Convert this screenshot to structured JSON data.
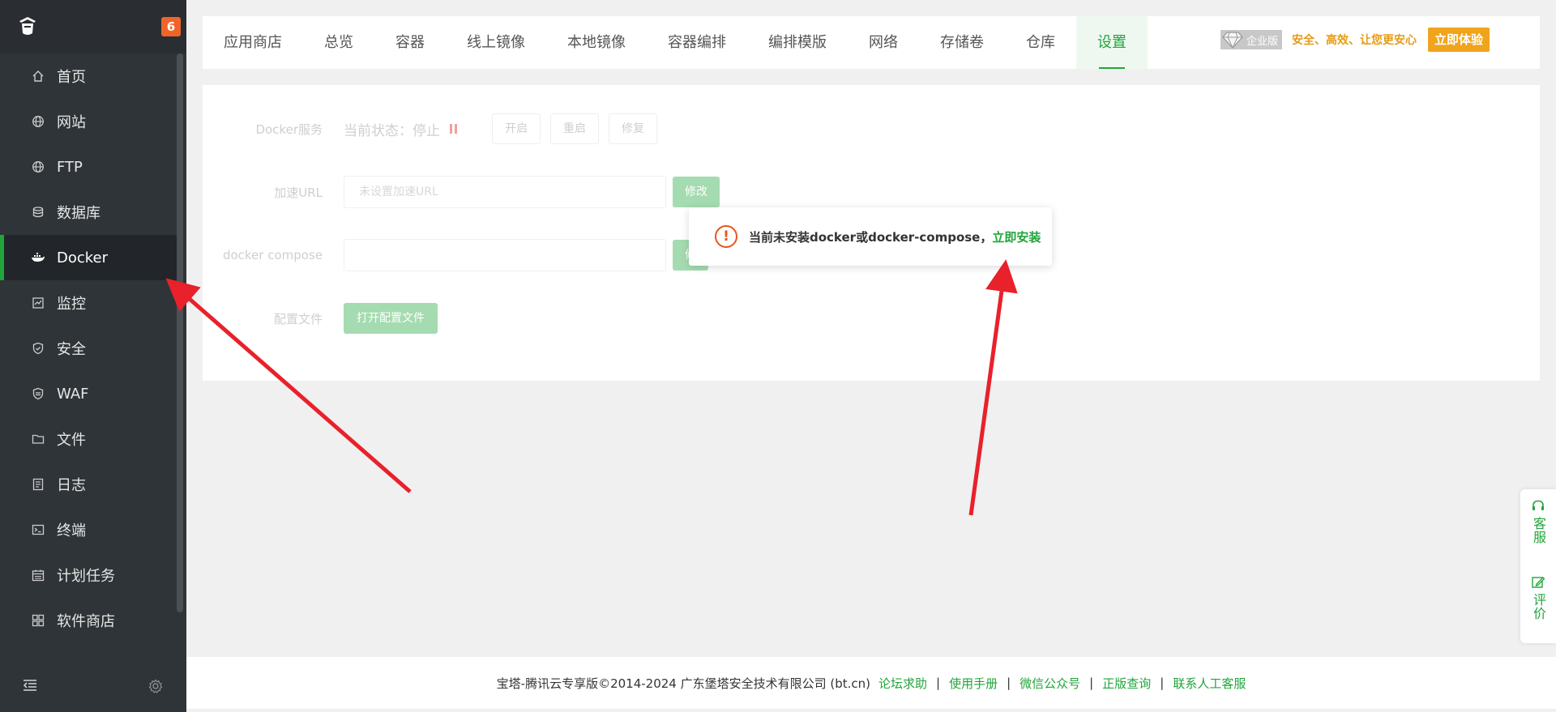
{
  "sidebar": {
    "badge": "6",
    "items": [
      {
        "label": "首页",
        "icon": "home-icon"
      },
      {
        "label": "网站",
        "icon": "globe-icon"
      },
      {
        "label": "FTP",
        "icon": "globe-icon"
      },
      {
        "label": "数据库",
        "icon": "database-icon"
      },
      {
        "label": "Docker",
        "icon": "docker-icon",
        "active": true
      },
      {
        "label": "监控",
        "icon": "monitor-icon"
      },
      {
        "label": "安全",
        "icon": "shield-icon"
      },
      {
        "label": "WAF",
        "icon": "waf-icon"
      },
      {
        "label": "文件",
        "icon": "folder-icon"
      },
      {
        "label": "日志",
        "icon": "log-icon"
      },
      {
        "label": "终端",
        "icon": "terminal-icon"
      },
      {
        "label": "计划任务",
        "icon": "calendar-icon"
      },
      {
        "label": "软件商店",
        "icon": "apps-icon"
      }
    ]
  },
  "tabs": [
    "应用商店",
    "总览",
    "容器",
    "线上镜像",
    "本地镜像",
    "容器编排",
    "编排模版",
    "网络",
    "存储卷",
    "仓库",
    "设置"
  ],
  "active_tab": "设置",
  "promo": {
    "tag": "企业版",
    "text": "安全、高效、让您更安心",
    "button": "立即体验"
  },
  "settings": {
    "service_label": "Docker服务",
    "status_text": "当前状态：停止",
    "start": "开启",
    "restart": "重启",
    "repair": "修复",
    "accel_label": "加速URL",
    "accel_placeholder": "未设置加速URL",
    "modify": "修改",
    "compose_label": "docker compose",
    "compose_modify": "修",
    "config_label": "配置文件",
    "open_config": "打开配置文件"
  },
  "popup": {
    "message": "当前未安装docker或docker-compose，",
    "link": "立即安装"
  },
  "footer": {
    "copyright": "宝塔-腾讯云专享版©2014-2024 广东堡塔安全技术有限公司 (bt.cn)",
    "links": [
      "论坛求助",
      "使用手册",
      "微信公众号",
      "正版查询",
      "联系人工客服"
    ],
    "separator": "|"
  },
  "float": {
    "service": "客服",
    "review": "评价"
  },
  "colors": {
    "sidebar_bg": "#2f3438",
    "accent": "#20a53a",
    "promo_orange": "#f0a41c",
    "warning": "#e7551f",
    "arrow": "#e8212b"
  }
}
